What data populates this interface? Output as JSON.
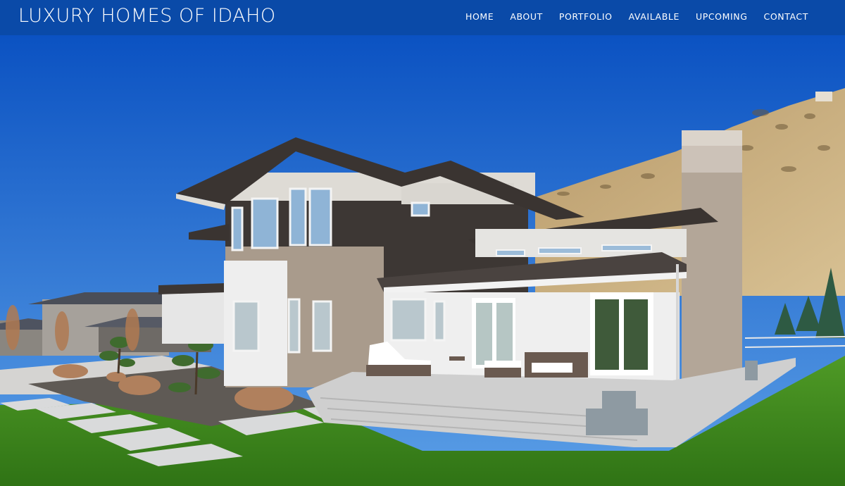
{
  "site": {
    "brand": "LUXURY HOMES OF IDAHO"
  },
  "nav": {
    "items": [
      {
        "label": "HOME"
      },
      {
        "label": "ABOUT"
      },
      {
        "label": "PORTFOLIO"
      },
      {
        "label": "AVAILABLE"
      },
      {
        "label": "UPCOMING"
      },
      {
        "label": "CONTACT"
      }
    ]
  },
  "colors": {
    "navbar": "#0a4aa8",
    "sky_top": "#0b52c2",
    "sky_bottom": "#5b9fe6",
    "hill": "#c9ae7e",
    "lawn": "#3e8a1d",
    "stucco": "#ededed",
    "brick": "#a99b8c",
    "dark_siding": "#3d3734",
    "roof": "#3a3431"
  },
  "hero": {
    "subject": "house-photo"
  }
}
